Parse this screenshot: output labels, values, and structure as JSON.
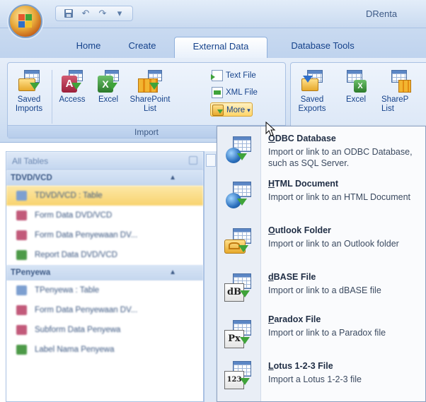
{
  "window": {
    "title": "DRenta"
  },
  "quick_access": {
    "icons": [
      "save-icon",
      "undo-icon",
      "redo-icon",
      "customize-icon"
    ]
  },
  "tabs": [
    {
      "label": "Home",
      "active": false
    },
    {
      "label": "Create",
      "active": false
    },
    {
      "label": "External Data",
      "active": true
    },
    {
      "label": "Database Tools",
      "active": false
    }
  ],
  "ribbon": {
    "import_group": {
      "label": "Import",
      "saved_imports": "Saved Imports",
      "access": "Access",
      "excel": "Excel",
      "sharepoint_list": "SharePoint List",
      "text_file": "Text File",
      "xml_file": "XML File",
      "more": "More"
    },
    "export_group": {
      "saved_exports": "Saved Exports",
      "excel": "Excel",
      "sharepoint_list": "ShareP List"
    }
  },
  "nav_pane": {
    "header": "All Tables",
    "groups": [
      {
        "label": "TDVD/VCD",
        "items": [
          "TDVD/VCD : Table",
          "Form Data DVD/VCD",
          "Form Data Penyewaan DV...",
          "Report Data DVD/VCD"
        ]
      },
      {
        "label": "TPenyewa",
        "items": [
          "TPenyewa : Table",
          "Form Data Penyewaan DV...",
          "Subform Data Penyewa",
          "Label Nama Penyewa"
        ]
      }
    ]
  },
  "menu": {
    "items": [
      {
        "title_u": "O",
        "title_rest": "DBC Database",
        "desc": "Import or link to an ODBC Database, such as SQL Server."
      },
      {
        "title_u": "H",
        "title_rest": "TML Document",
        "desc": "Import or link to an HTML Document"
      },
      {
        "title_u": "O",
        "title_rest": "utlook Folder",
        "desc": "Import or link to an Outlook folder"
      },
      {
        "title_u": "d",
        "title_rest": "BASE File",
        "desc": "Import or link to a dBASE file"
      },
      {
        "title_u": "P",
        "title_rest": "aradox File",
        "desc": "Import or link to a Paradox file"
      },
      {
        "title_u": "L",
        "title_rest": "otus 1-2-3 File",
        "desc": "Import a Lotus 1-2-3 file"
      }
    ],
    "badges": {
      "dbase": "dB",
      "paradox": "Px",
      "lotus": "123"
    }
  },
  "colors": {
    "accent": "#15428b",
    "highlight": "#ffd56a"
  }
}
